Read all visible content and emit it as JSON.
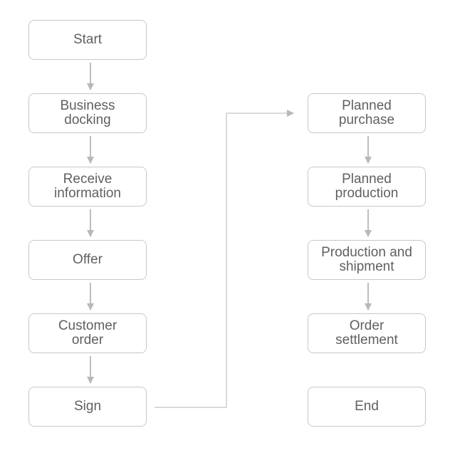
{
  "diagram": {
    "left_column": [
      {
        "label": "Start"
      },
      {
        "label": "Business docking"
      },
      {
        "label": "Receive information"
      },
      {
        "label": "Offer"
      },
      {
        "label": "Customer order"
      },
      {
        "label": "Sign"
      }
    ],
    "right_column": [
      {
        "label": "Planned purchase"
      },
      {
        "label": "Planned production"
      },
      {
        "label": "Production and shipment"
      },
      {
        "label": "Order settlement"
      },
      {
        "label": "End"
      }
    ],
    "line_color": "#c0c0c0",
    "box_border_color": "#c8c8c8",
    "text_color": "#606060"
  }
}
